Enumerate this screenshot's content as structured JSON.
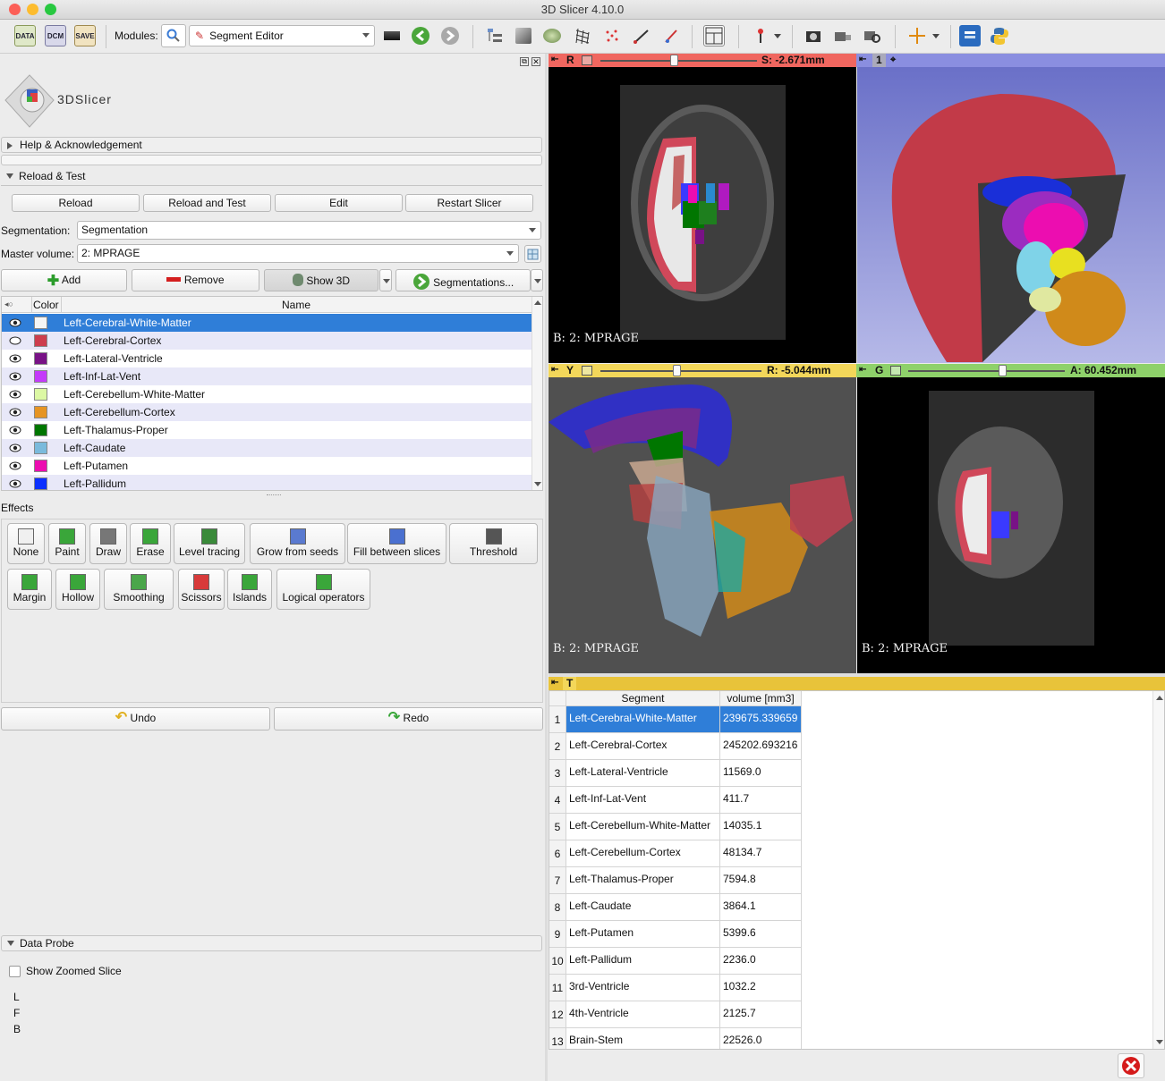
{
  "window": {
    "title": "3D Slicer 4.10.0"
  },
  "toolbar": {
    "data_label": "DATA",
    "dcm_label": "DCM",
    "save_label": "SAVE",
    "modules_label": "Modules:",
    "module_selected": "Segment Editor"
  },
  "logo": {
    "text": "3DSlicer"
  },
  "sections": {
    "help": "Help & Acknowledgement",
    "reload": "Reload & Test",
    "data_probe": "Data Probe"
  },
  "reload_buttons": [
    "Reload",
    "Reload and Test",
    "Edit",
    "Restart Slicer"
  ],
  "segmentation": {
    "label": "Segmentation:",
    "value": "Segmentation"
  },
  "master_volume": {
    "label": "Master volume:",
    "value": "2: MPRAGE"
  },
  "seg_actions": {
    "add": "Add",
    "remove": "Remove",
    "show3d": "Show 3D",
    "segmentations": "Segmentations..."
  },
  "segment_table": {
    "columns": [
      "Color",
      "Name"
    ],
    "rows": [
      {
        "name": "Left-Cerebral-White-Matter",
        "color": "#f5f5f5"
      },
      {
        "name": "Left-Cerebral-Cortex",
        "color": "#cd3e4e"
      },
      {
        "name": "Left-Lateral-Ventricle",
        "color": "#781286"
      },
      {
        "name": "Left-Inf-Lat-Vent",
        "color": "#c43afa"
      },
      {
        "name": "Left-Cerebellum-White-Matter",
        "color": "#dcf8a4"
      },
      {
        "name": "Left-Cerebellum-Cortex",
        "color": "#e69422"
      },
      {
        "name": "Left-Thalamus-Proper",
        "color": "#007600"
      },
      {
        "name": "Left-Caudate",
        "color": "#7abadc"
      },
      {
        "name": "Left-Putamen",
        "color": "#ec0db0"
      },
      {
        "name": "Left-Pallidum",
        "color": "#0c30ff"
      }
    ]
  },
  "effects": {
    "label": "Effects",
    "row1": [
      "None",
      "Paint",
      "Draw",
      "Erase",
      "Level tracing",
      "Grow from seeds",
      "Fill between slices",
      "Threshold"
    ],
    "row2": [
      "Margin",
      "Hollow",
      "Smoothing",
      "Scissors",
      "Islands",
      "Logical operators"
    ]
  },
  "undo": "Undo",
  "redo": "Redo",
  "data_probe": {
    "show_zoomed": "Show Zoomed Slice",
    "letters": [
      "L",
      "F",
      "B"
    ]
  },
  "views": {
    "red": {
      "letter": "R",
      "offset": "S: -2.671mm",
      "label": "B: 2: MPRAGE",
      "slider_fraction": 0.47
    },
    "three_d": {
      "number": "1"
    },
    "yellow": {
      "letter": "Y",
      "offset": "R: -5.044mm",
      "label": "B: 2: MPRAGE",
      "slider_fraction": 0.47
    },
    "green": {
      "letter": "G",
      "offset": "A: 60.452mm",
      "label": "B: 2: MPRAGE",
      "slider_fraction": 0.6
    },
    "table": {
      "letter": "T"
    }
  },
  "stats_table": {
    "columns": [
      "Segment",
      "volume [mm3]"
    ],
    "rows": [
      {
        "n": "1",
        "segment": "Left-Cerebral-White-Matter",
        "volume": "239675.339659"
      },
      {
        "n": "2",
        "segment": "Left-Cerebral-Cortex",
        "volume": "245202.693216"
      },
      {
        "n": "3",
        "segment": "Left-Lateral-Ventricle",
        "volume": "11569.0"
      },
      {
        "n": "4",
        "segment": "Left-Inf-Lat-Vent",
        "volume": "411.7"
      },
      {
        "n": "5",
        "segment": "Left-Cerebellum-White-Matter",
        "volume": "14035.1"
      },
      {
        "n": "6",
        "segment": "Left-Cerebellum-Cortex",
        "volume": "48134.7"
      },
      {
        "n": "7",
        "segment": "Left-Thalamus-Proper",
        "volume": "7594.8"
      },
      {
        "n": "8",
        "segment": "Left-Caudate",
        "volume": "3864.1"
      },
      {
        "n": "9",
        "segment": "Left-Putamen",
        "volume": "5399.6"
      },
      {
        "n": "10",
        "segment": "Left-Pallidum",
        "volume": "2236.0"
      },
      {
        "n": "11",
        "segment": "3rd-Ventricle",
        "volume": "1032.2"
      },
      {
        "n": "12",
        "segment": "4th-Ventricle",
        "volume": "2125.7"
      },
      {
        "n": "13",
        "segment": "Brain-Stem",
        "volume": "22526.0"
      }
    ]
  },
  "colors": {
    "selection": "#2f7ed8",
    "red_bar": "#f0665f",
    "view3d_bar": "#8a8ee0",
    "yellow_bar": "#f3d75a",
    "green_bar": "#8ed16a"
  }
}
